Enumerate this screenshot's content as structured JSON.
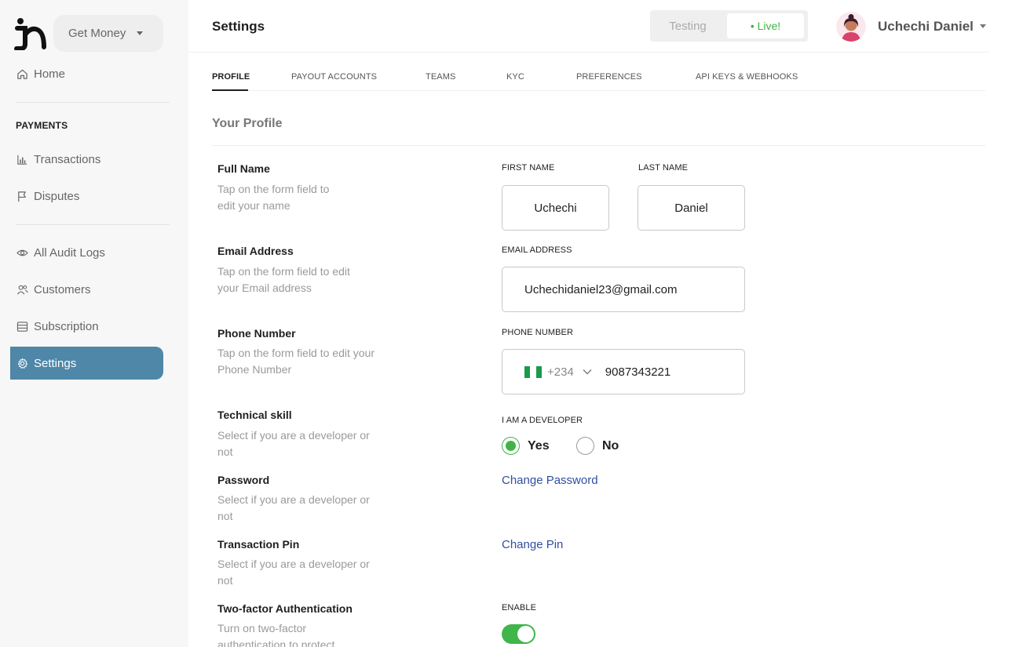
{
  "org": {
    "name": "Get Money"
  },
  "sidebar": {
    "home": "Home",
    "payments_heading": "PAYMENTS",
    "items": [
      {
        "label": "Transactions",
        "icon": "bar-chart-icon"
      },
      {
        "label": "Disputes",
        "icon": "flag-icon"
      },
      {
        "label": "All Audit Logs",
        "icon": "eye-icon"
      },
      {
        "label": "Customers",
        "icon": "users-icon"
      },
      {
        "label": "Subscription",
        "icon": "list-icon"
      },
      {
        "label": "Settings",
        "icon": "gear-icon",
        "active": true
      }
    ]
  },
  "header": {
    "title": "Settings",
    "env": {
      "testing": "Testing",
      "live": "• Live!"
    },
    "user_name": "Uchechi Daniel"
  },
  "tabs": [
    {
      "label": "PROFILE",
      "active": true
    },
    {
      "label": "PAYOUT ACCOUNTS"
    },
    {
      "label": "TEAMS"
    },
    {
      "label": "KYC"
    },
    {
      "label": "PREFERENCES"
    },
    {
      "label": "API KEYS & WEBHOOKS"
    }
  ],
  "profile": {
    "section_title": "Your Profile",
    "full_name": {
      "title": "Full Name",
      "desc": "Tap on the form field to edit your name",
      "first_label": "FIRST NAME",
      "first_value": "Uchechi",
      "last_label": "LAST NAME",
      "last_value": "Daniel"
    },
    "email": {
      "title": "Email Address",
      "desc": "Tap on the form field to edit your Email address",
      "label": "EMAIL ADDRESS",
      "value": "Uchechidaniel23@gmail.com"
    },
    "phone": {
      "title": "Phone Number",
      "desc": "Tap on the form field to edit your Phone Number",
      "label": "PHONE NUMBER",
      "dial_code": "+234",
      "value": "9087343221"
    },
    "developer": {
      "title": "Technical skill",
      "desc": "Select if you are a developer or not",
      "label": "I AM A DEVELOPER",
      "yes": "Yes",
      "no": "No",
      "selected": "Yes"
    },
    "password": {
      "title": "Password",
      "desc": "Select if you are a developer or not",
      "link": "Change Password"
    },
    "pin": {
      "title": "Transaction Pin",
      "desc": "Select if you are a developer or not",
      "link": "Change Pin"
    },
    "two_factor": {
      "title": "Two-factor Authentication",
      "desc": "Turn on two-factor authentication to protect",
      "label": "ENABLE",
      "enabled": true
    }
  },
  "colors": {
    "accent": "#4e87a8",
    "live_green": "#41b346",
    "link_blue": "#2f4fa3"
  }
}
